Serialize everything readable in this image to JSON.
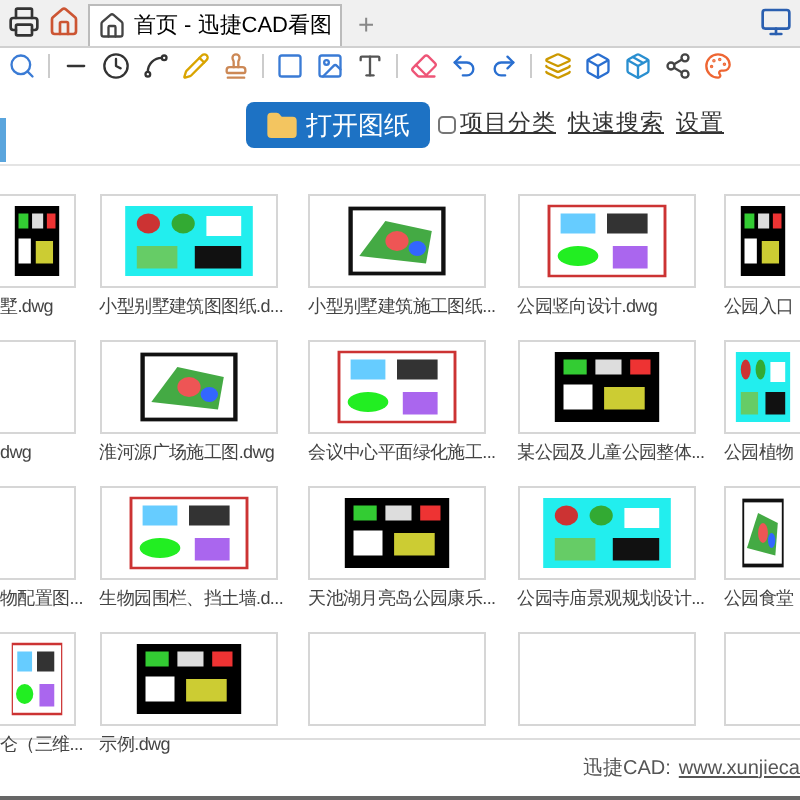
{
  "tabs": [
    {
      "label": "首页 - 迅捷CAD看图",
      "selected": true
    }
  ],
  "new_tab": "+",
  "header": {
    "open_button": "打开图纸",
    "category_checkbox": {
      "label": "项目分类",
      "checked": false
    },
    "links": [
      "快速搜索",
      "设置"
    ]
  },
  "files": [
    {
      "label": "墅.dwg",
      "kind": "picture"
    },
    {
      "label": "小型别墅建筑图图纸.d...",
      "kind": "picture"
    },
    {
      "label": "小型别墅建筑施工图纸...",
      "kind": "picture"
    },
    {
      "label": "公园竖向设计.dwg",
      "kind": "picture"
    },
    {
      "label": "公园入口",
      "kind": "picture"
    },
    {
      "label": "dwg",
      "kind": "empty"
    },
    {
      "label": "淮河源广场施工图.dwg",
      "kind": "picture"
    },
    {
      "label": "会议中心平面绿化施工...",
      "kind": "picture"
    },
    {
      "label": "某公园及儿童公园整体...",
      "kind": "picture"
    },
    {
      "label": "公园植物",
      "kind": "picture"
    },
    {
      "label": "物配置图...",
      "kind": "empty"
    },
    {
      "label": "生物园围栏、挡土墙.d...",
      "kind": "picture"
    },
    {
      "label": "天池湖月亮岛公园康乐...",
      "kind": "picture"
    },
    {
      "label": "公园寺庙景观规划设计...",
      "kind": "picture"
    },
    {
      "label": "公园食堂",
      "kind": "picture"
    },
    {
      "label": "仑（三维...",
      "kind": "picture"
    },
    {
      "label": "示例.dwg",
      "kind": "picture"
    },
    {
      "kind": "empty"
    },
    {
      "kind": "empty"
    },
    {
      "kind": "empty"
    }
  ],
  "footer": {
    "label": "迅捷CAD:",
    "link": "www.xunjieca"
  }
}
